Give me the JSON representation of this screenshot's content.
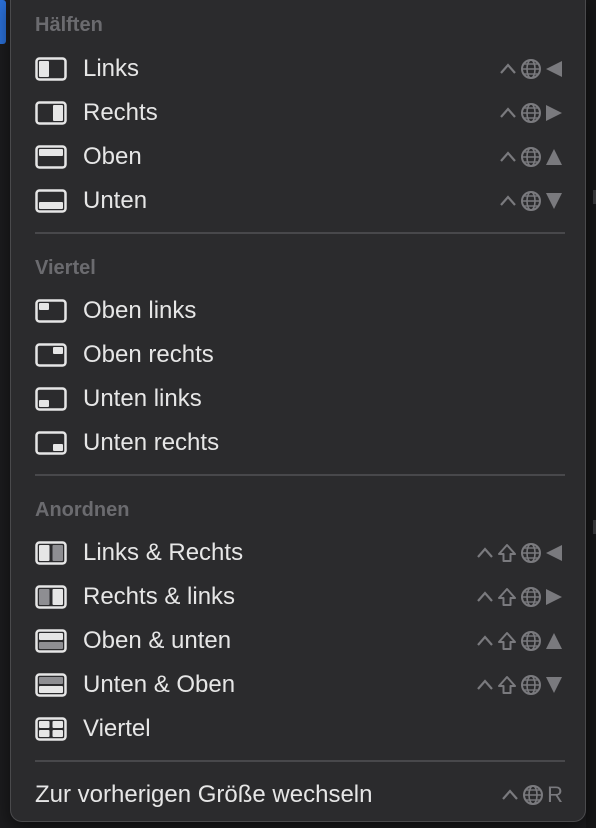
{
  "sections": {
    "halves": {
      "title": "Hälften",
      "items": [
        {
          "label": "Links",
          "icon": "half-left-icon",
          "keys": [
            "ctrl",
            "globe",
            "left"
          ]
        },
        {
          "label": "Rechts",
          "icon": "half-right-icon",
          "keys": [
            "ctrl",
            "globe",
            "right"
          ]
        },
        {
          "label": "Oben",
          "icon": "half-top-icon",
          "keys": [
            "ctrl",
            "globe",
            "up"
          ]
        },
        {
          "label": "Unten",
          "icon": "half-bottom-icon",
          "keys": [
            "ctrl",
            "globe",
            "down"
          ]
        }
      ]
    },
    "quarters": {
      "title": "Viertel",
      "items": [
        {
          "label": "Oben links",
          "icon": "quarter-top-left-icon"
        },
        {
          "label": "Oben rechts",
          "icon": "quarter-top-right-icon"
        },
        {
          "label": "Unten links",
          "icon": "quarter-bottom-left-icon"
        },
        {
          "label": "Unten rechts",
          "icon": "quarter-bottom-right-icon"
        }
      ]
    },
    "arrange": {
      "title": "Anordnen",
      "items": [
        {
          "label": "Links & Rechts",
          "icon": "split-left-right-icon",
          "keys": [
            "ctrl",
            "shift",
            "globe",
            "left"
          ]
        },
        {
          "label": "Rechts & links",
          "icon": "split-right-left-icon",
          "keys": [
            "ctrl",
            "shift",
            "globe",
            "right"
          ]
        },
        {
          "label": "Oben & unten",
          "icon": "split-top-bottom-icon",
          "keys": [
            "ctrl",
            "shift",
            "globe",
            "up"
          ]
        },
        {
          "label": "Unten & Oben",
          "icon": "split-bottom-top-icon",
          "keys": [
            "ctrl",
            "shift",
            "globe",
            "down"
          ]
        },
        {
          "label": "Viertel",
          "icon": "quarters-grid-icon"
        }
      ]
    }
  },
  "footer": {
    "label": "Zur vorherigen Größe wechseln",
    "shortcut_letter": "R"
  },
  "colors": {
    "menu_background": "#2b2b2d",
    "text": "#e6e6e6",
    "section_title": "#6b6b6f",
    "shortcut": "#7a7a7e",
    "separator": "#48484b"
  }
}
